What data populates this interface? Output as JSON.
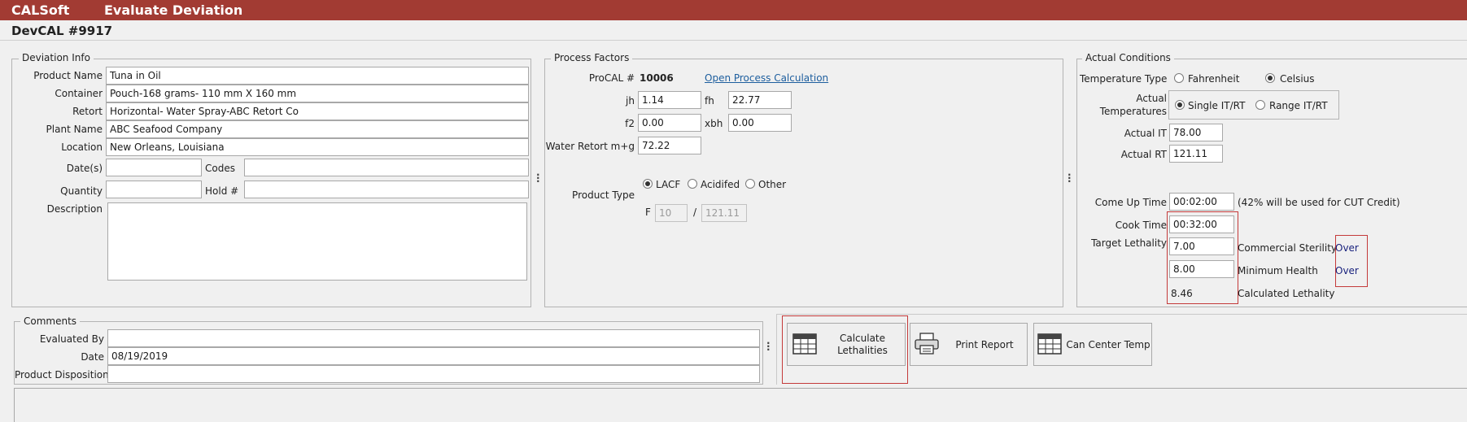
{
  "app": {
    "name": "CALSoft",
    "window_title": "Evaluate Deviation"
  },
  "record": {
    "title": "DevCAL #9917"
  },
  "deviation_info": {
    "legend": "Deviation Info",
    "product_name_label": "Product Name",
    "product_name": "Tuna in Oil",
    "container_label": "Container",
    "container": "Pouch-168 grams- 110 mm X 160 mm",
    "retort_label": "Retort",
    "retort": "Horizontal- Water Spray-ABC Retort Co",
    "plant_name_label": "Plant Name",
    "plant_name": "ABC Seafood Company",
    "location_label": "Location",
    "location": "New Orleans, Louisiana",
    "dates_label": "Date(s)",
    "dates": "",
    "codes_label": "Codes",
    "codes": "",
    "quantity_label": "Quantity",
    "quantity": "",
    "hold_label": "Hold #",
    "hold": "",
    "description_label": "Description",
    "description": ""
  },
  "process_factors": {
    "legend": "Process Factors",
    "procal_label": "ProCAL #",
    "procal_number": "10006",
    "open_link": "Open Process Calculation",
    "jh_label": "jh",
    "jh": "1.14",
    "fh_label": "fh",
    "fh": "22.77",
    "f2_label": "f2",
    "f2": "0.00",
    "xbh_label": "xbh",
    "xbh": "0.00",
    "water_retort_label": "Water Retort m+g",
    "water_retort": "72.22",
    "product_type_label": "Product Type",
    "product_types": [
      "LACF",
      "Acidifed",
      "Other"
    ],
    "product_type_selected": "LACF",
    "f_label": "F",
    "f_value": "10",
    "slash": "/",
    "f_temp": "121.11"
  },
  "actual_conditions": {
    "legend": "Actual Conditions",
    "temp_type_label": "Temperature Type",
    "temp_types": [
      "Fahrenheit",
      "Celsius"
    ],
    "temp_type_selected": "Celsius",
    "actual_temps_label_1": "Actual",
    "actual_temps_label_2": "Temperatures",
    "temp_modes": [
      "Single IT/RT",
      "Range IT/RT"
    ],
    "temp_mode_selected": "Single IT/RT",
    "actual_it_label": "Actual IT",
    "actual_it": "78.00",
    "actual_rt_label": "Actual RT",
    "actual_rt": "121.11",
    "come_up_label": "Come Up Time",
    "come_up": "00:02:00",
    "come_up_note": "(42% will be used for CUT Credit)",
    "cook_time_label": "Cook Time",
    "cook_time": "00:32:00",
    "target_lethality_label": "Target Lethality",
    "commercial_sterility": "7.00",
    "commercial_sterility_label": "Commercial Sterility",
    "commercial_sterility_status": "Over",
    "minimum_health": "8.00",
    "minimum_health_label": "Minimum Health",
    "minimum_health_status": "Over",
    "calculated_lethality": "8.46",
    "calculated_lethality_label": "Calculated Lethality"
  },
  "comments": {
    "legend": "Comments",
    "evaluated_by_label": "Evaluated By",
    "evaluated_by": "",
    "date_label": "Date",
    "date": "08/19/2019",
    "disposition_label": "Product Disposition",
    "disposition": ""
  },
  "actions": {
    "calculate_line1": "Calculate",
    "calculate_line2": "Lethalities",
    "print_report": "Print Report",
    "can_center_temp": "Can Center Temp"
  },
  "colors": {
    "title_bar": "#a23b33",
    "highlight_box": "#c43a3a",
    "status_text": "#1a237e",
    "link": "#1d5e9e"
  }
}
